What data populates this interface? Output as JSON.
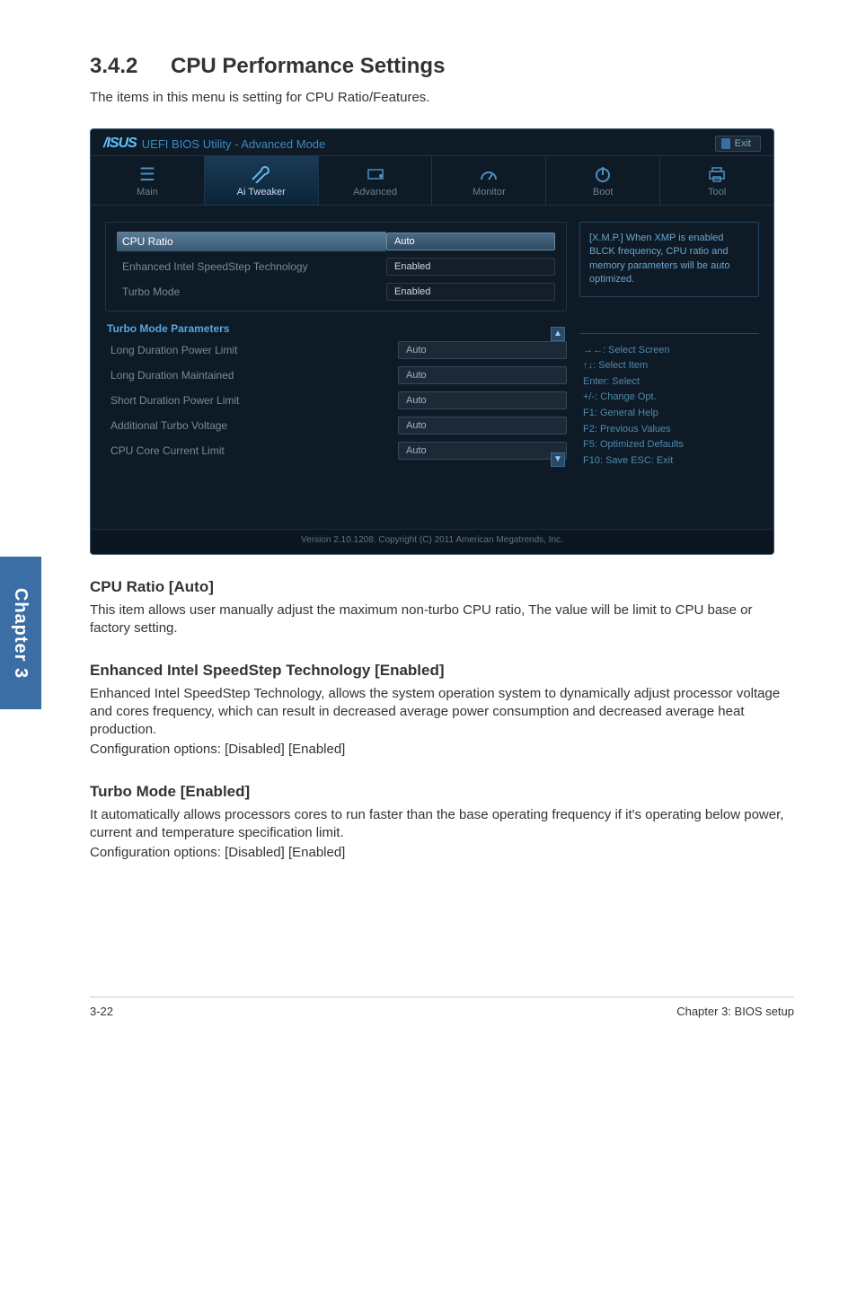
{
  "doc": {
    "section_num": "3.4.2",
    "section_title": "CPU Performance Settings",
    "lead": "The items in this menu is setting for CPU Ratio/Features.",
    "sub1_title": "CPU Ratio [Auto]",
    "sub1_body": "This item allows user manually adjust the maximum non-turbo CPU ratio, The value will be limit to CPU base or factory setting.",
    "sub2_title": "Enhanced Intel SpeedStep Technology [Enabled]",
    "sub2_body1": "Enhanced Intel SpeedStep Technology, allows the system operation system to dynamically adjust processor voltage and cores frequency, which can result in decreased average power consumption and decreased average heat production.",
    "sub2_body2": "Configuration options: [Disabled] [Enabled]",
    "sub3_title": "Turbo Mode [Enabled]",
    "sub3_body1": "It automatically allows processors cores to run faster than the base operating frequency if it's operating below power, current and temperature specification limit.",
    "sub3_body2": "Configuration options: [Disabled] [Enabled]",
    "side_tab": "Chapter 3",
    "footer_left": "3-22",
    "footer_right": "Chapter 3: BIOS setup"
  },
  "bios": {
    "title": "UEFI BIOS Utility - Advanced Mode",
    "exit": "Exit",
    "tabs": [
      {
        "label": "Main",
        "icon": "list-icon"
      },
      {
        "label": "Ai  Tweaker",
        "icon": "wrench-icon"
      },
      {
        "label": "Advanced",
        "icon": "chip-icon"
      },
      {
        "label": "Monitor",
        "icon": "gauge-icon"
      },
      {
        "label": "Boot",
        "icon": "power-icon"
      },
      {
        "label": "Tool",
        "icon": "printer-icon"
      }
    ],
    "rows_top": [
      {
        "label": "CPU Ratio",
        "value": "Auto",
        "style": "sel"
      },
      {
        "label": "Enhanced Intel SpeedStep Technology",
        "value": "Enabled",
        "style": "dark"
      },
      {
        "label": "Turbo Mode",
        "value": "Enabled",
        "style": "dark"
      }
    ],
    "group_header": "Turbo Mode Parameters",
    "rows_bottom": [
      {
        "label": "Long Duration Power Limit",
        "value": "Auto"
      },
      {
        "label": "Long Duration Maintained",
        "value": "Auto"
      },
      {
        "label": "Short Duration Power Limit",
        "value": "Auto"
      },
      {
        "label": "Additional Turbo Voltage",
        "value": "Auto"
      },
      {
        "label": "CPU Core Current Limit",
        "value": "Auto"
      }
    ],
    "hint": "[X.M.P.] When XMP is enabled BLCK frequency, CPU ratio and memory parameters will be auto optimized.",
    "help": [
      "→←:  Select Screen",
      "↑↓:  Select Item",
      "Enter:  Select",
      "+/-:  Change Opt.",
      "F1:  General Help",
      "F2:  Previous Values",
      "F5:  Optimized Defaults",
      "F10:  Save   ESC:  Exit"
    ],
    "footer": "Version  2.10.1208.   Copyright  (C)  2011  American  Megatrends,  Inc."
  }
}
